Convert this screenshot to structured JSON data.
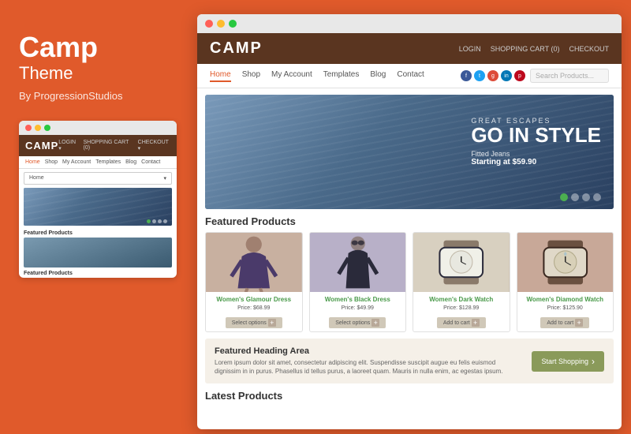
{
  "left_panel": {
    "title": "Camp",
    "subtitle": "Theme",
    "by": "By ProgressionStudios"
  },
  "mini_browser": {
    "logo": "CAMP",
    "header_actions": [
      "LOGIN",
      "SHOPPING CART (0)",
      "CHECKOUT"
    ],
    "nav_active": "Home",
    "dropdown": "Home",
    "featured_label": "Featured Products"
  },
  "main_browser": {
    "logo": "CAMP",
    "header_actions": {
      "login": "LOGIN",
      "cart": "SHOPPING CART (0)",
      "checkout": "CHECKOUT"
    },
    "nav_items": [
      "Home",
      "Shop",
      "My Account",
      "Templates",
      "Blog",
      "Contact"
    ],
    "nav_active": "Home",
    "search_placeholder": "Search Products...",
    "hero": {
      "eyebrow": "GREAT ESCAPES",
      "main_text": "GO IN STYLE",
      "product_name": "Fitted Jeans",
      "price_prefix": "Starting at",
      "price": "$59.90"
    },
    "featured_products_label": "Featured Products",
    "products": [
      {
        "name": "Women's Glamour Dress",
        "price": "Price: $68.99",
        "button": "Select options"
      },
      {
        "name": "Women's Black Dress",
        "price": "Price: $49.99",
        "button": "Select options"
      },
      {
        "name": "Women's Dark Watch",
        "price": "Price: $128.99",
        "button": "Add to cart"
      },
      {
        "name": "Women's Diamond Watch",
        "price": "Price: $125.90",
        "button": "Add to cart"
      }
    ],
    "featured_area": {
      "heading": "Featured Heading Area",
      "description": "Lorem ipsum dolor sit amet, consectetur adipiscing elit. Suspendisse suscipit augue eu felis euismod dignissim in in purus. Phasellus id tellus purus, a laoreet quam. Mauris in nulla enim, ac egestas ipsum.",
      "button": "Start Shopping"
    },
    "latest_label": "Latest Products"
  }
}
